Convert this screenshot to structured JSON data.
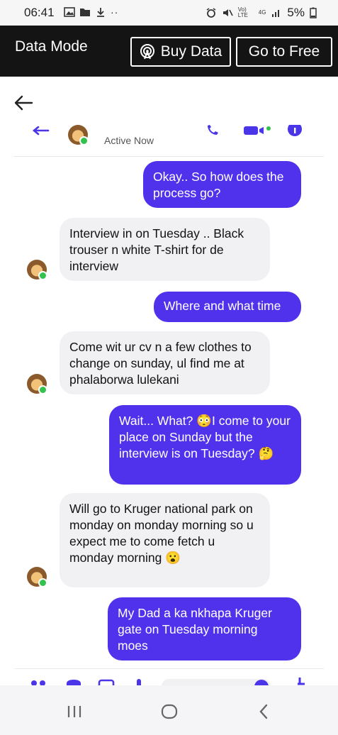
{
  "status_bar": {
    "time": "06:41",
    "network_label": "Vo) LTE",
    "network_type": "4G",
    "battery": "5%"
  },
  "banner": {
    "title": "Data Mode",
    "buy_label": "Buy Data",
    "free_label": "Go to Free"
  },
  "chat": {
    "active_status": "Active Now",
    "messages": [
      {
        "from": "me",
        "text": "Okay.. So how does the process go?"
      },
      {
        "from": "them",
        "text": "Interview in on Tuesday .. Black trouser n white T-shirt for de interview"
      },
      {
        "from": "me",
        "text": "Where and what time"
      },
      {
        "from": "them",
        "text": "Come wit ur cv n a few clothes to change on sunday, ul find me at phalaborwa lulekani"
      },
      {
        "from": "me",
        "text": "Wait... What? 😳I come to your place on Sunday but the interview is on Tuesday? 🤔"
      },
      {
        "from": "them",
        "text": "Will go to Kruger national park on monday on monday morning so u expect me to come fetch u monday morning 😮"
      },
      {
        "from": "me",
        "text": "My Dad a ka nkhapa Kruger gate on Tuesday morning moes"
      }
    ]
  },
  "colors": {
    "outgoing_bubble": "#5132ec",
    "incoming_bubble": "#f1f1f4",
    "banner": "#141414",
    "active_dot": "#33c24d"
  }
}
